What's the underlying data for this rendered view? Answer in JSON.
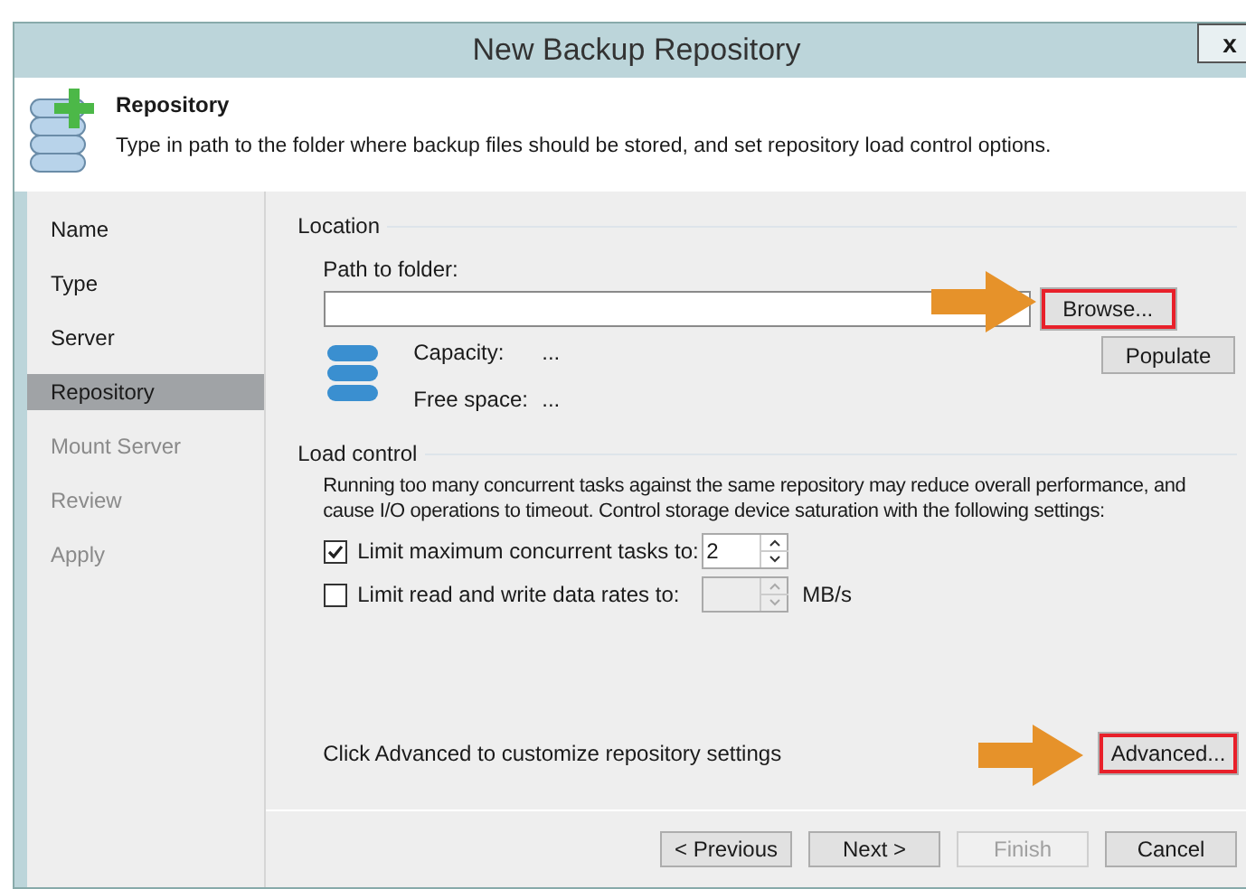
{
  "window": {
    "title": "New Backup Repository",
    "close": "x"
  },
  "header": {
    "title": "Repository",
    "description": "Type in path to the folder where backup files should be stored, and set repository load control options."
  },
  "sidebar": {
    "items": [
      {
        "label": "Name",
        "selected": false,
        "disabled": false
      },
      {
        "label": "Type",
        "selected": false,
        "disabled": false
      },
      {
        "label": "Server",
        "selected": false,
        "disabled": false
      },
      {
        "label": "Repository",
        "selected": true,
        "disabled": false
      },
      {
        "label": "Mount Server",
        "selected": false,
        "disabled": true
      },
      {
        "label": "Review",
        "selected": false,
        "disabled": true
      },
      {
        "label": "Apply",
        "selected": false,
        "disabled": true
      }
    ]
  },
  "location": {
    "title": "Location",
    "path_label": "Path to folder:",
    "browse_button": {
      "label": "Browse...",
      "highlighted": true
    },
    "populate_button": {
      "label": "Populate",
      "highlighted": false
    },
    "capacity_label": "Capacity:",
    "capacity_value": "...",
    "free_label": "Free space:",
    "free_value": "..."
  },
  "load_control": {
    "title": "Load control",
    "description": "Running too many concurrent tasks against the same repository may reduce overall performance, and cause I/O operations to timeout. Control storage device saturation with the following settings:",
    "options": [
      {
        "label": "Limit maximum concurrent tasks to:",
        "checked": true,
        "value": "2"
      },
      {
        "label": "Limit read and write data rates to:",
        "checked": false,
        "unit": "MB/s"
      }
    ]
  },
  "advanced": {
    "hint": "Click Advanced to customize repository settings",
    "button": {
      "label": "Advanced...",
      "highlighted": true
    }
  },
  "footer": {
    "buttons": [
      {
        "label": "< Previous",
        "disabled": false
      },
      {
        "label": "Next >",
        "disabled": false
      },
      {
        "label": "Finish",
        "disabled": true
      },
      {
        "label": "Cancel",
        "disabled": false
      }
    ]
  }
}
